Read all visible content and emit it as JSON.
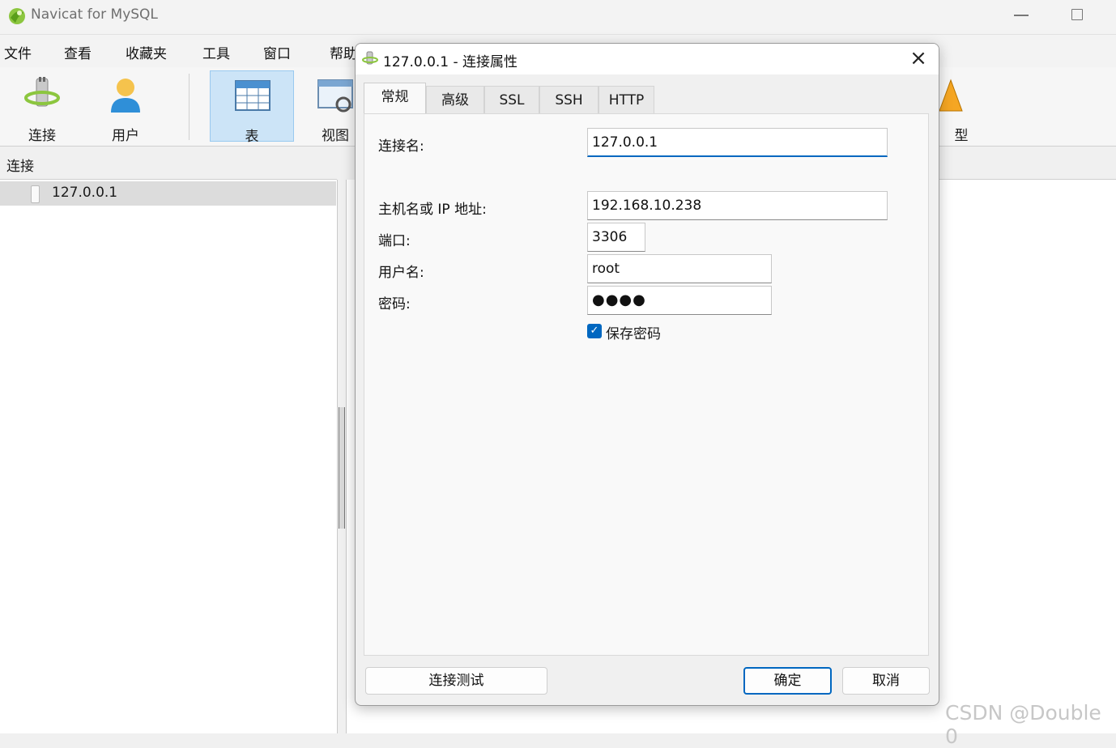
{
  "app": {
    "title": "Navicat for MySQL"
  },
  "menu": [
    "文件",
    "查看",
    "收藏夹",
    "工具",
    "窗口",
    "帮助"
  ],
  "toolbar": {
    "connect": "连接",
    "user": "用户",
    "table": "表",
    "view": "视图",
    "model_partial": "型"
  },
  "connections": {
    "header": "连接",
    "items": [
      "127.0.0.1"
    ]
  },
  "dialog": {
    "title": "127.0.0.1 - 连接属性",
    "tabs": [
      "常规",
      "高级",
      "SSL",
      "SSH",
      "HTTP"
    ],
    "active_tab": "常规",
    "fields": {
      "conn_name_label": "连接名:",
      "conn_name_value": "127.0.0.1",
      "host_label": "主机名或 IP 地址:",
      "host_value": "192.168.10.238",
      "port_label": "端口:",
      "port_value": "3306",
      "user_label": "用户名:",
      "user_value": "root",
      "password_label": "密码:",
      "password_dots": "●●●●",
      "save_password_label": "保存密码"
    },
    "buttons": {
      "test": "连接测试",
      "ok": "确定",
      "cancel": "取消"
    }
  },
  "watermark": "CSDN @Double 0",
  "colors": {
    "accent": "#0067c0",
    "selected_tool": "#cce4f7"
  }
}
